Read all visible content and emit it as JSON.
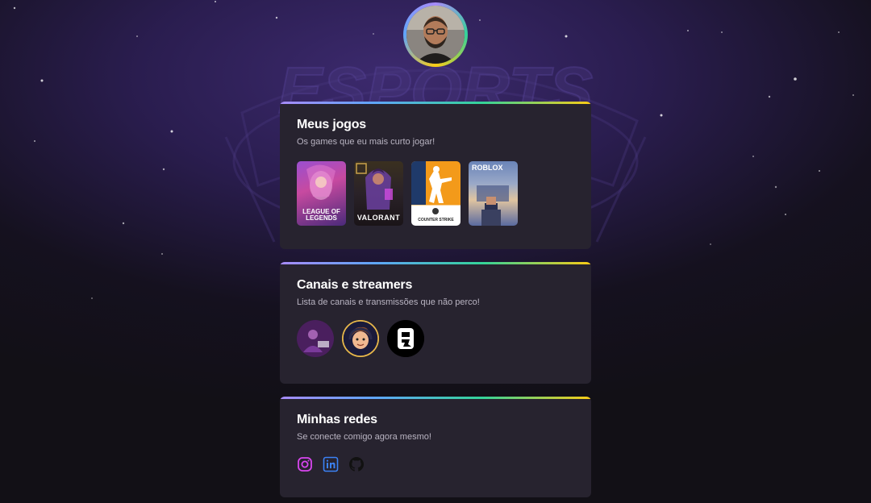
{
  "background": {
    "watermark_text": "ESPORTS"
  },
  "profile": {
    "avatar": "profile-photo"
  },
  "sections": {
    "games": {
      "title": "Meus jogos",
      "subtitle": "Os games que eu mais curto jogar!",
      "items": [
        {
          "name": "League of Legends",
          "label": "LEAGUE OF LEGENDS",
          "icon": "league-of-legends-cover"
        },
        {
          "name": "Valorant",
          "label": "VALORANT",
          "icon": "valorant-cover"
        },
        {
          "name": "Counter-Strike",
          "label": "COUNTER STRIKE",
          "icon": "counter-strike-cover"
        },
        {
          "name": "Roblox",
          "label": "ROBLOX",
          "icon": "roblox-cover"
        }
      ]
    },
    "channels": {
      "title": "Canais e streamers",
      "subtitle": "Lista de canais e transmissões que não perco!",
      "items": [
        {
          "icon": "streamer-avatar-1"
        },
        {
          "icon": "streamer-avatar-2"
        },
        {
          "icon": "streamer-avatar-3"
        }
      ]
    },
    "networks": {
      "title": "Minhas redes",
      "subtitle": "Se conecte comigo agora mesmo!",
      "items": [
        {
          "icon": "instagram-icon",
          "color": "#d946ef"
        },
        {
          "icon": "linkedin-icon",
          "color": "#3b82f6"
        },
        {
          "icon": "github-icon",
          "color": "#111111"
        }
      ]
    }
  },
  "colors": {
    "card_bg": "#27232f",
    "accent_gradient": [
      "#a78bfa",
      "#60a5fa",
      "#34d399",
      "#facc15"
    ]
  }
}
